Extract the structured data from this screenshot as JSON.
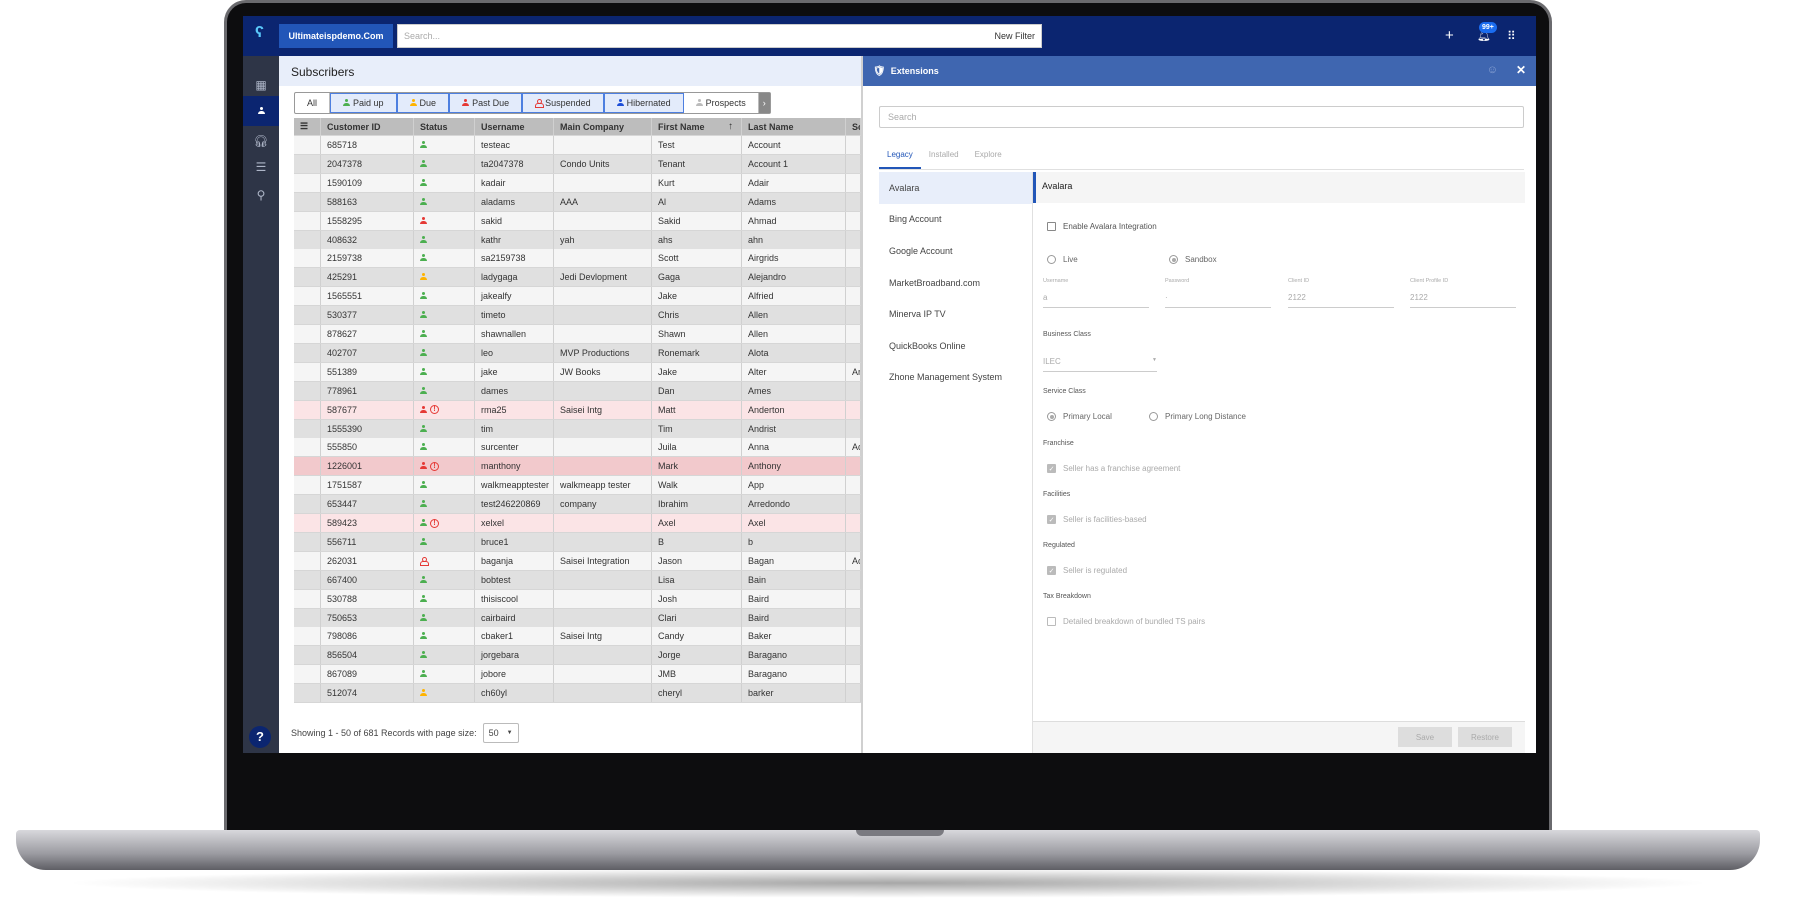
{
  "topbar": {
    "domain": "Ultimateispdemo.Com",
    "search_placeholder": "Search...",
    "new_filter": "New Filter",
    "notification_count": "99+"
  },
  "sidebar": {
    "items": [
      "dashboard-icon",
      "subscribers-icon",
      "support-icon",
      "list-icon",
      "location-icon"
    ],
    "active": "subscribers",
    "help": "?"
  },
  "subscribers": {
    "title": "Subscribers",
    "filters": [
      "All",
      "Paid up",
      "Due",
      "Past Due",
      "Suspended",
      "Hibernated",
      "Prospects"
    ],
    "columns": [
      "Customer ID",
      "Status",
      "Username",
      "Main Company",
      "First Name",
      "Last Name",
      "Sc"
    ],
    "rows": [
      [
        "685718",
        "paid",
        "testeac",
        "",
        "Test",
        "Account",
        "",
        ""
      ],
      [
        "2047378",
        "paid",
        "ta2047378",
        "Condo Units",
        "Tenant",
        "Account 1",
        "",
        ""
      ],
      [
        "1590109",
        "paid",
        "kadair",
        "",
        "Kurt",
        "Adair",
        "",
        ""
      ],
      [
        "588163",
        "paid",
        "aladams",
        "AAA",
        "Al",
        "Adams",
        "",
        ""
      ],
      [
        "1558295",
        "pastdue",
        "sakid",
        "",
        "Sakid",
        "Ahmad",
        "",
        ""
      ],
      [
        "408632",
        "paid",
        "kathr",
        "yah",
        "ahs",
        "ahn",
        "",
        ""
      ],
      [
        "2159738",
        "paid",
        "sa2159738",
        "",
        "Scott",
        "Airgrids",
        "",
        ""
      ],
      [
        "425291",
        "due",
        "ladygaga",
        "Jedi Devlopment",
        "Gaga",
        "Alejandro",
        "",
        ""
      ],
      [
        "1565551",
        "paid",
        "jakealfy",
        "",
        "Jake",
        "Alfried",
        "",
        ""
      ],
      [
        "530377",
        "paid",
        "timeto",
        "",
        "Chris",
        "Allen",
        "",
        ""
      ],
      [
        "878627",
        "paid",
        "shawnallen",
        "",
        "Shawn",
        "Allen",
        "",
        ""
      ],
      [
        "402707",
        "paid",
        "leo",
        "MVP Productions",
        "Ronemark",
        "Alota",
        "",
        ""
      ],
      [
        "551389",
        "paid",
        "jake",
        "JW Books",
        "Jake",
        "Alter",
        "Ar",
        ""
      ],
      [
        "778961",
        "paid",
        "dames",
        "",
        "Dan",
        "Ames",
        "",
        ""
      ],
      [
        "587677",
        "pastdue",
        "rma25",
        "Saisei Intg",
        "Matt",
        "Anderton",
        "",
        "alert"
      ],
      [
        "1555390",
        "paid",
        "tim",
        "",
        "Tim",
        "Andrist",
        "",
        ""
      ],
      [
        "555850",
        "paid",
        "surcenter",
        "",
        "Juila",
        "Anna",
        "Ac",
        ""
      ],
      [
        "1226001",
        "pastdue",
        "manthony",
        "",
        "Mark",
        "Anthony",
        "",
        "alert-strong"
      ],
      [
        "1751587",
        "paid",
        "walkmeapptester",
        "walkmeapp tester",
        "Walk",
        "App",
        "",
        ""
      ],
      [
        "653447",
        "paid",
        "test246220869",
        "company",
        "Ibrahim",
        "Arredondo",
        "",
        ""
      ],
      [
        "589423",
        "paid",
        "xelxel",
        "",
        "Axel",
        "Axel",
        "",
        "alert"
      ],
      [
        "556711",
        "paid",
        "bruce1",
        "",
        "B",
        "b",
        "",
        ""
      ],
      [
        "262031",
        "suspended",
        "baganja",
        "Saisei Integration",
        "Jason",
        "Bagan",
        "Ac",
        ""
      ],
      [
        "667400",
        "paid",
        "bobtest",
        "",
        "Lisa",
        "Bain",
        "",
        ""
      ],
      [
        "530788",
        "paid",
        "thisiscool",
        "",
        "Josh",
        "Baird",
        "",
        ""
      ],
      [
        "750653",
        "paid",
        "cairbaird",
        "",
        "Clari",
        "Baird",
        "",
        ""
      ],
      [
        "798086",
        "paid",
        "cbaker1",
        "Saisei Intg",
        "Candy",
        "Baker",
        "",
        ""
      ],
      [
        "856504",
        "paid",
        "jorgebara",
        "",
        "Jorge",
        "Baragano",
        "",
        ""
      ],
      [
        "867089",
        "paid",
        "jobore",
        "",
        "JMB",
        "Baragano",
        "",
        ""
      ],
      [
        "512074",
        "due",
        "ch60yl",
        "",
        "cheryl",
        "barker",
        "",
        ""
      ]
    ],
    "footer": "Showing 1 - 50 of 681 Records with page size:",
    "page_size": "50"
  },
  "extensions": {
    "title": "Extensions",
    "search_placeholder": "Search",
    "tabs": [
      "Legacy",
      "Installed",
      "Explore"
    ],
    "list": [
      "Avalara",
      "Bing Account",
      "Google Account",
      "MarketBroadband.com",
      "Minerva IP TV",
      "QuickBooks Online",
      "Zhone Management System"
    ],
    "detail": {
      "title": "Avalara",
      "enable": "Enable Avalara Integration",
      "mode": [
        "Live",
        "Sandbox"
      ],
      "fields": [
        {
          "label": "Username",
          "value": "a"
        },
        {
          "label": "Password",
          "value": "·"
        },
        {
          "label": "Client ID",
          "value": "2122"
        },
        {
          "label": "Client Profile ID",
          "value": "2122"
        }
      ],
      "business_class_label": "Business Class",
      "business_class": "ILEC",
      "service_class_label": "Service Class",
      "service_class": [
        "Primary Local",
        "Primary Long Distance"
      ],
      "franchise_label": "Franchise",
      "franchise": "Seller has a franchise agreement",
      "facilities_label": "Facilities",
      "facilities": "Seller is facilities-based",
      "regulated_label": "Regulated",
      "regulated": "Seller is regulated",
      "tax_label": "Tax Breakdown",
      "tax": "Detailed breakdown of bundled TS pairs",
      "save": "Save",
      "restore": "Restore"
    }
  },
  "colors": {
    "topbar": "#0b2570",
    "accent": "#2256b8",
    "ext_header": "#3f66b0",
    "paid": "#4caf50",
    "due": "#ffb300",
    "pastdue": "#e53935",
    "hibernated": "#1e4fd8"
  }
}
